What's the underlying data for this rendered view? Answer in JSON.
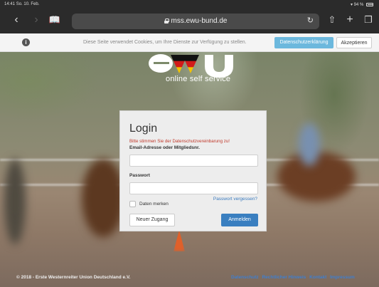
{
  "status_bar": {
    "time": "14:41",
    "date": "So. 10. Feb.",
    "wifi_icon": "wifi-icon",
    "battery": "94 %"
  },
  "browser": {
    "url": "mss.ewu-bund.de",
    "back_icon": "back-chevron-icon",
    "forward_icon": "forward-chevron-icon",
    "bookmarks_icon": "bookmarks-icon",
    "reload_icon": "reload-icon",
    "share_icon": "share-icon",
    "new_tab_icon": "plus-icon",
    "tabs_icon": "tabs-icon"
  },
  "cookie_bar": {
    "text": "Diese Seite verwendet Cookies, um Ihre Dienste zur Verfügung zu stellen.",
    "policy_button": "Datenschutzerklärung",
    "accept_button": "Akzeptieren"
  },
  "logo": {
    "wordmark": "ewu",
    "subtitle": "online self service"
  },
  "login": {
    "title": "Login",
    "warning": "Bitte stimmen Sie der Datenschutzvereinbarung zu!",
    "email_label": "Email-Adresse oder Mitgliedsnr.",
    "email_value": "",
    "password_label": "Passwort",
    "password_value": "",
    "remember_label": "Daten merken",
    "forgot_link": "Passwort vergessen?",
    "new_account_button": "Neuer Zugang",
    "submit_button": "Anmelden"
  },
  "footer": {
    "copyright": "© 2018 - Erste Westernreiter Union Deutschland e.V.",
    "links": [
      "Datenschutz",
      "Rechtlicher Hinweis",
      "Kontakt",
      "Impressum"
    ]
  },
  "colors": {
    "primary_button": "#3a7fc0",
    "cookie_policy_button": "#6cb8dd",
    "warning_text": "#c0392b",
    "link": "#3a7bbf"
  }
}
